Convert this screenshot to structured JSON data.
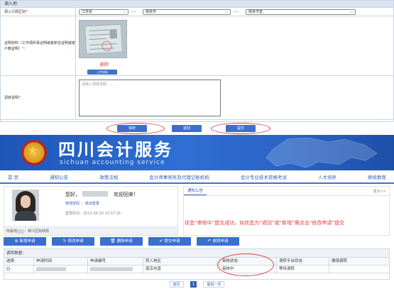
{
  "form": {
    "header": "调入地",
    "region_label": "调入行政区划",
    "region_required_mark": "*",
    "province": "江苏省",
    "city": "南京市",
    "district": "南京市直",
    "separator": "----",
    "cert_label": "证明材料（工作场所事证明或者新任证明或者户籍证明）",
    "cert_required_mark": "*",
    "delete_link": "删除",
    "upload_button": "上传材料",
    "reason_label": "调转说明",
    "reason_required_mark": "*",
    "reason_placeholder": "请输入调转说明......",
    "buttons": {
      "save": "保存",
      "back": "返回",
      "submit": "提交"
    }
  },
  "portal": {
    "title": "四川会计服务",
    "subtitle": "sichuan accounting service",
    "nav": [
      "首 页",
      "通知公告",
      "政策法规",
      "会计师事务所及代理记账机构",
      "会计专业技术资格考试",
      "人才培养",
      "继续教育"
    ]
  },
  "user": {
    "greeting_prefix": "您好，",
    "greeting_suffix": "欢迎回来！",
    "edit_link": "修改密码",
    "link_sep": "|",
    "logout_link": "退出登录",
    "login_time": "登录时间：2023-06-20 15:57:25",
    "org_prefix": "所属地",
    "org_value": "锦江区财政局"
  },
  "notice": {
    "tab": "通知公告",
    "more": "更多>>"
  },
  "annotation": "状态“审核中”提交成功，如状态为“退回”或“新增”需点击“修改申请”提交",
  "actions": [
    {
      "icon": "⊕",
      "label": "新增申请"
    },
    {
      "icon": "✎",
      "label": "修改申请"
    },
    {
      "icon": "🗑",
      "label": "删除申请"
    },
    {
      "icon": "✔",
      "label": "提交申请"
    },
    {
      "icon": "↶",
      "label": "收回申请"
    }
  ],
  "table": {
    "title": "调转数据：",
    "headers": [
      "选择",
      "申请时间",
      "申请编号",
      "转入地区",
      "审核状态",
      "调转平台状态",
      "撤销调转"
    ],
    "rows": [
      {
        "apply_time": "",
        "apply_no": "",
        "region": "南京市直",
        "status": "审核中",
        "platform_status": "等待调转",
        "revoke": ""
      }
    ]
  },
  "pager": {
    "first": "首页",
    "page": "1",
    "last": "最后一页",
    "dots": "·"
  },
  "colors": {
    "primary": "#3a6fd0",
    "highlight": "#e53935",
    "banner": "#2a63c4"
  }
}
